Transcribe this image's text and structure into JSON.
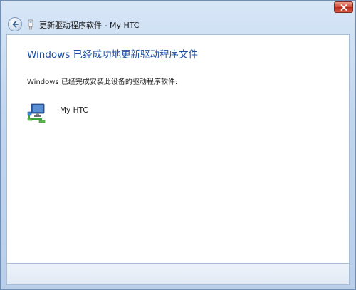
{
  "window": {
    "title": "更新驱动程序软件 - My HTC",
    "close_label": "×"
  },
  "content": {
    "heading": "Windows 已经成功地更新驱动程序文件",
    "subtext": "Windows 已经完成安装此设备的驱动程序软件:",
    "device_name": "My HTC"
  },
  "icons": {
    "back": "back-arrow-icon",
    "device_small": "usb-device-icon",
    "device": "network-device-icon",
    "close": "close-icon"
  },
  "colors": {
    "heading": "#1e4fa0",
    "close_button": "#cf4a35",
    "frame": "#c2d6ee"
  }
}
